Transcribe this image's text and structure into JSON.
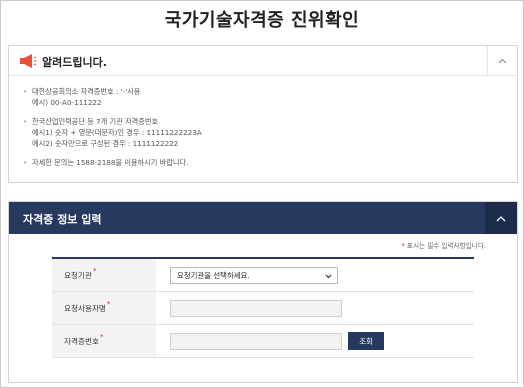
{
  "page": {
    "title": "국가기술자격증 진위확인"
  },
  "notice": {
    "title": "알려드립니다.",
    "items": [
      {
        "lines": [
          "대한상공회의소 자격증번호 : '-'사용",
          "예시) 00-A0-111222"
        ]
      },
      {
        "lines": [
          "한국산업인력공단 등 7개 기관 자격증번호",
          "예시1) 숫자 + 영문(대문자)인 경우 : 11111222223A",
          "예시2) 숫자만으로 구성된 경우 : 1111122222"
        ]
      },
      {
        "lines": [
          "자세한 문의는 1588-2188을 이용하시기 바랍니다."
        ]
      }
    ]
  },
  "form_section": {
    "title": "자격증 정보 입력",
    "required_note": "표시는 필수 입력사항입니다.",
    "fields": {
      "org": {
        "label": "요청기관",
        "selected": "요청기관을 선택하세요."
      },
      "user": {
        "label": "요청사용자명",
        "value": ""
      },
      "cert": {
        "label": "자격증번호",
        "value": "",
        "button": "조회"
      }
    }
  },
  "colors": {
    "primary": "#27395e",
    "required": "#e02020",
    "icon": "#e8503a"
  },
  "icons": {
    "notice": "megaphone-icon",
    "collapse": "chevron-up-icon",
    "dropdown": "caret-down-icon"
  }
}
